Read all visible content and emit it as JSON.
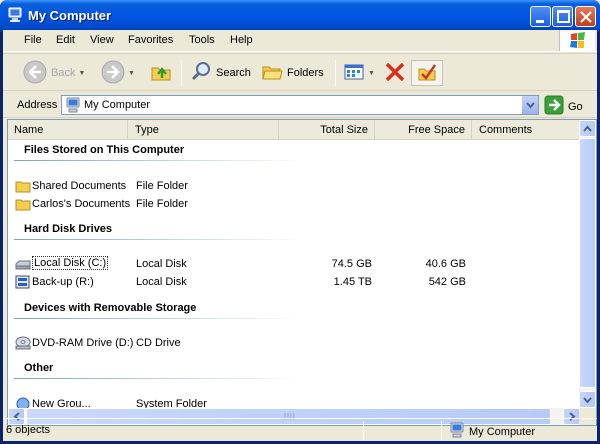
{
  "window": {
    "title": "My Computer"
  },
  "menu": [
    "File",
    "Edit",
    "View",
    "Favorites",
    "Tools",
    "Help"
  ],
  "toolbar": {
    "back": "Back",
    "search": "Search",
    "folders": "Folders"
  },
  "address": {
    "label": "Address",
    "value": "My Computer",
    "go": "Go"
  },
  "columns": {
    "name": "Name",
    "type": "Type",
    "total_size": "Total Size",
    "free_space": "Free Space",
    "comments": "Comments"
  },
  "groups": [
    {
      "title": "Files Stored on This Computer",
      "items": [
        {
          "name": "Shared Documents",
          "type": "File Folder",
          "total": "",
          "free": "",
          "icon": "folder-icon"
        },
        {
          "name": "Carlos's Documents",
          "type": "File Folder",
          "total": "",
          "free": "",
          "icon": "folder-icon"
        }
      ]
    },
    {
      "title": "Hard Disk Drives",
      "items": [
        {
          "name": "Local Disk (C:)",
          "type": "Local Disk",
          "total": "74.5 GB",
          "free": "40.6 GB",
          "icon": "hard-drive-icon"
        },
        {
          "name": "Back-up (R:)",
          "type": "Local Disk",
          "total": "1.45 TB",
          "free": "542 GB",
          "icon": "network-drive-icon"
        }
      ]
    },
    {
      "title": "Devices with Removable Storage",
      "items": [
        {
          "name": "DVD-RAM Drive (D:)",
          "type": "CD Drive",
          "total": "",
          "free": "",
          "icon": "dvd-drive-icon"
        }
      ]
    },
    {
      "title": "Other",
      "items": [
        {
          "name": "New Grou...",
          "type": "System Folder",
          "total": "",
          "free": "",
          "icon": "control-panel-icon"
        }
      ]
    }
  ],
  "status": {
    "count": "6 objects",
    "location": "My Computer"
  },
  "colors": {
    "title_blue": "#0055E5",
    "window_bg": "#ECE9D8",
    "group_line": "#7AA0DA"
  }
}
